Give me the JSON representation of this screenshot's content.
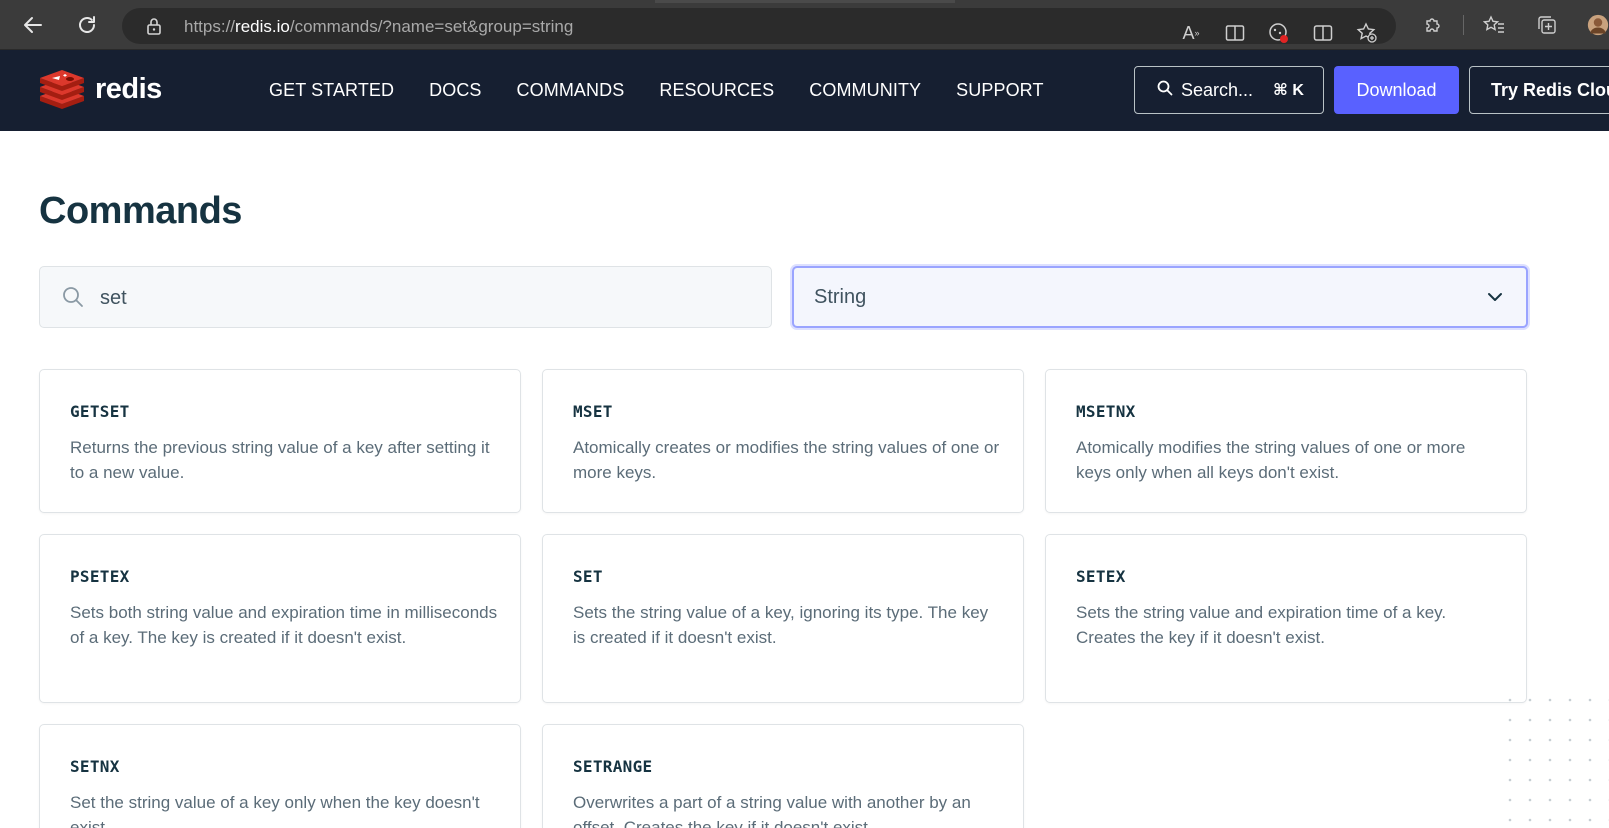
{
  "browser": {
    "url_prefix": "https://",
    "url_host": "redis.io",
    "url_rest": "/commands/?name=set&group=string"
  },
  "header": {
    "logo_text": "redis",
    "nav": [
      "GET STARTED",
      "DOCS",
      "COMMANDS",
      "RESOURCES",
      "COMMUNITY",
      "SUPPORT"
    ],
    "search_label": "Search...",
    "search_shortcut": "⌘ K",
    "download_label": "Download",
    "cloud_label": "Try Redis Cloud"
  },
  "main": {
    "title": "Commands",
    "search_value": "set",
    "group_value": "String"
  },
  "commands": [
    {
      "name": "GETSET",
      "desc": "Returns the previous string value of a key after setting it to a new value."
    },
    {
      "name": "MSET",
      "desc": "Atomically creates or modifies the string values of one or more keys."
    },
    {
      "name": "MSETNX",
      "desc": "Atomically modifies the string values of one or more keys only when all keys don't exist."
    },
    {
      "name": "PSETEX",
      "desc": "Sets both string value and expiration time in milliseconds of a key. The key is created if it doesn't exist."
    },
    {
      "name": "SET",
      "desc": "Sets the string value of a key, ignoring its type. The key is created if it doesn't exist."
    },
    {
      "name": "SETEX",
      "desc": "Sets the string value and expiration time of a key. Creates the key if it doesn't exist."
    },
    {
      "name": "SETNX",
      "desc": "Set the string value of a key only when the key doesn't exist."
    },
    {
      "name": "SETRANGE",
      "desc": "Overwrites a part of a string value with another by an offset. Creates the key if it doesn't exist."
    }
  ],
  "colors": {
    "header_bg": "#161f31",
    "accent": "#5961ff",
    "logo_red": "#dc382c",
    "text": "#163341"
  }
}
